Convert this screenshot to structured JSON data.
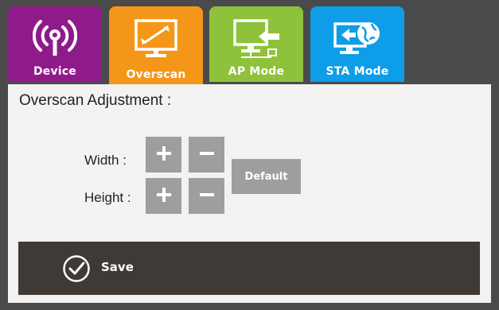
{
  "tabs": [
    {
      "label": "Device",
      "icon": "wireless-signal-icon",
      "color": "#8f1a8a"
    },
    {
      "label": "Overscan",
      "icon": "monitor-resize-icon",
      "color": "#f49719",
      "active": true
    },
    {
      "label": "AP Mode",
      "icon": "monitor-network-icon",
      "color": "#8ec23a"
    },
    {
      "label": "STA Mode",
      "icon": "monitor-globe-icon",
      "color": "#0e9de8"
    }
  ],
  "panel": {
    "title": "Overscan Adjustment :",
    "width_label": "Width :",
    "height_label": "Height :",
    "increase_symbol": "+",
    "decrease_symbol": "−",
    "default_label": "Default"
  },
  "save": {
    "label": "Save",
    "icon": "check-circle-icon"
  }
}
